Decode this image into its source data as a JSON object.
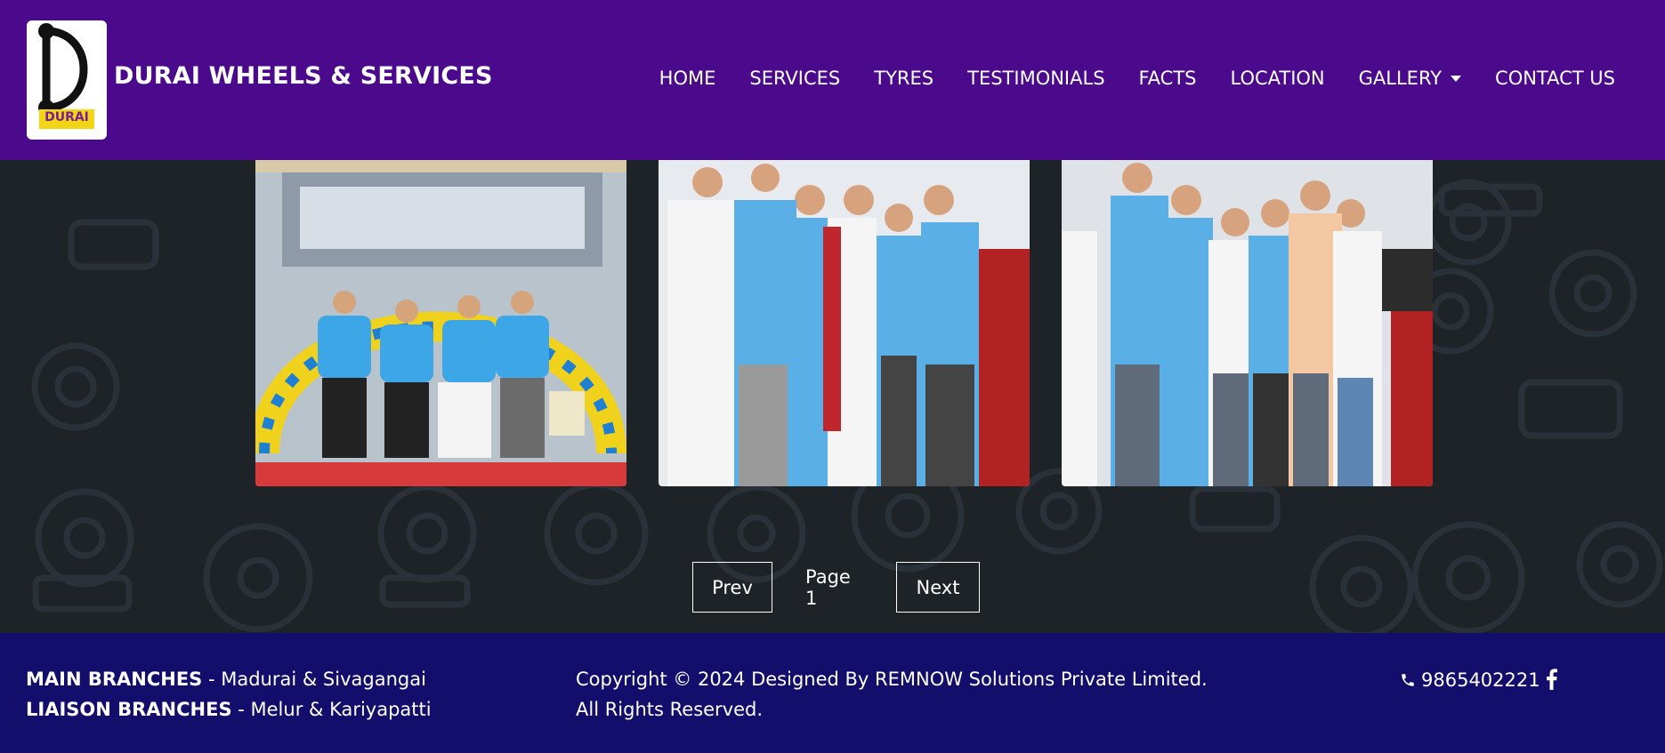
{
  "brand": {
    "name": "DURAI WHEELS & SERVICES",
    "logo_text": "DURAI"
  },
  "nav": {
    "items": [
      {
        "label": "HOME"
      },
      {
        "label": "SERVICES"
      },
      {
        "label": "TYRES"
      },
      {
        "label": "TESTIMONIALS"
      },
      {
        "label": "FACTS"
      },
      {
        "label": "LOCATION"
      },
      {
        "label": "GALLERY"
      },
      {
        "label": "CONTACT US"
      }
    ]
  },
  "gallery": {
    "photos": [
      {
        "name": "shop-opening-photo"
      },
      {
        "name": "group-photo-2"
      },
      {
        "name": "group-photo-3"
      }
    ]
  },
  "pagination": {
    "prev_label": "Prev",
    "page_label": "Page 1",
    "next_label": "Next"
  },
  "footer": {
    "main_branches_title": "MAIN BRANCHES",
    "main_branches_value": " - Madurai & Sivagangai",
    "liaison_branches_title": "LIAISON BRANCHES",
    "liaison_branches_value": " - Melur & Kariyapatti",
    "copyright_line1": "Copyright © 2024 Designed By REMNOW Solutions Private Limited.",
    "copyright_line2": "All Rights Reserved.",
    "phone": "9865402221"
  },
  "colors": {
    "navbar": "#4b0a8c",
    "body": "#1e2328",
    "footer": "#130d6b"
  },
  "icons": {
    "phone": "phone-icon",
    "facebook": "facebook-icon"
  }
}
